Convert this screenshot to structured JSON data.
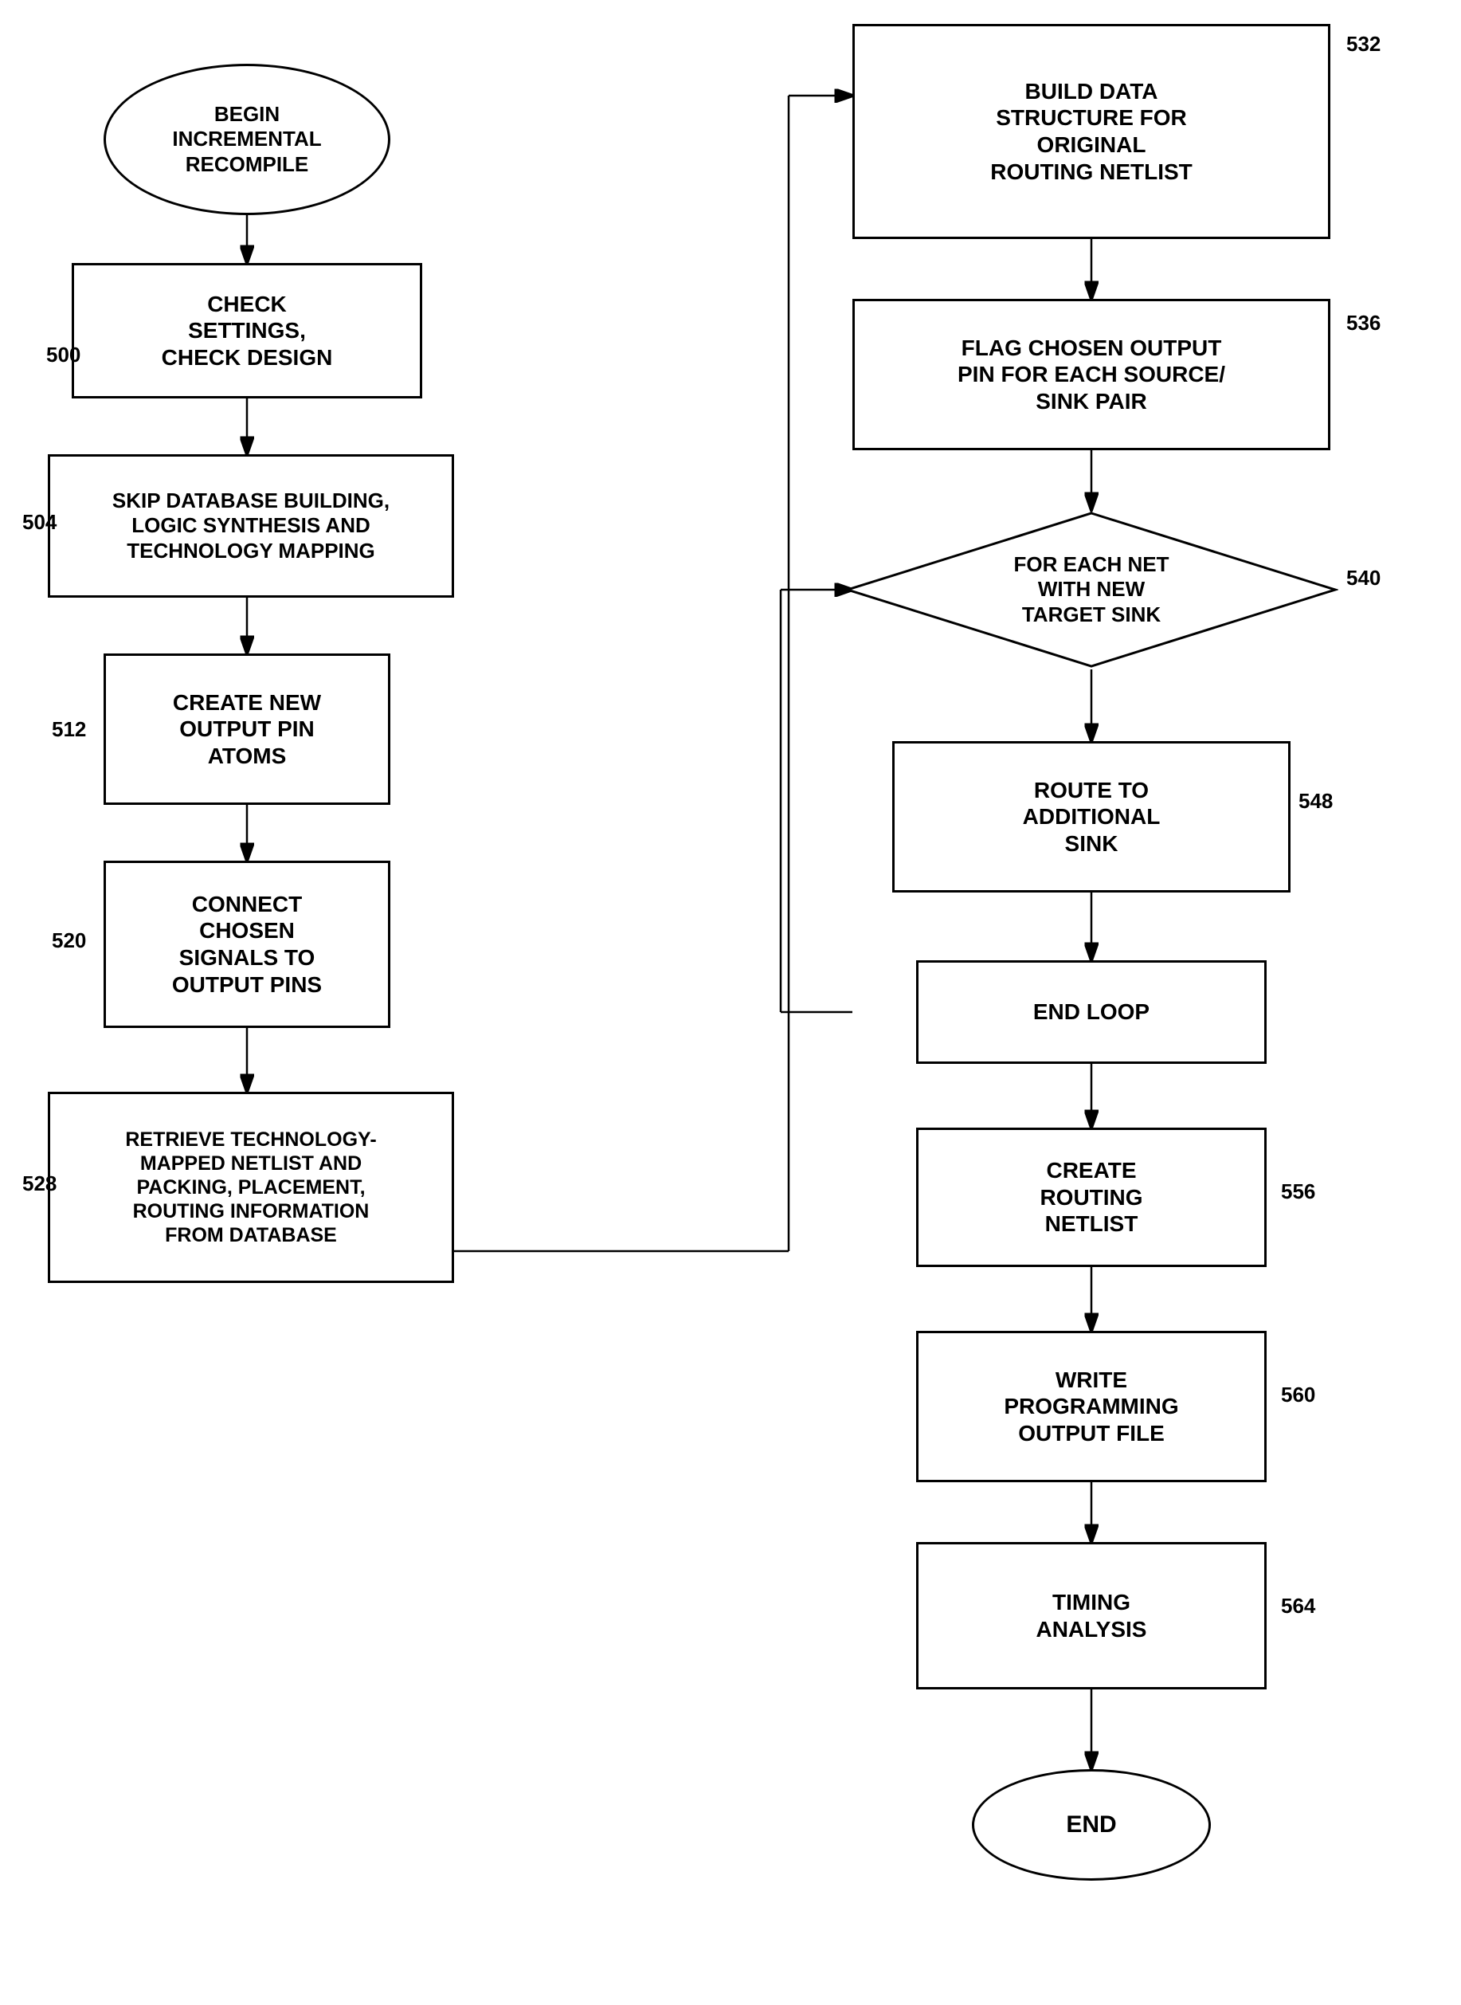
{
  "nodes": {
    "begin": {
      "label": "BEGIN\nINCREMENTAL\nRECOMPILE"
    },
    "n500": {
      "label": "CHECK\nSETTINGS,\nCHECK DESIGN",
      "ref": "500"
    },
    "n504": {
      "label": "SKIP DATABASE BUILDING,\nLOGIC SYNTHESIS AND\nTECHNOLOGY MAPPING",
      "ref": "504"
    },
    "n512": {
      "label": "CREATE NEW\nOUTPUT PIN\nATOMS",
      "ref": "512"
    },
    "n520": {
      "label": "CONNECT\nCHOSEN\nSIGNALS TO\nOUTPUT PINS",
      "ref": "520"
    },
    "n528": {
      "label": "RETRIEVE TECHNOLOGY-\nMAPPED NETLIST AND\nPACKING, PLACEMENT,\nROUTING INFORMATION\nFROM DATABASE",
      "ref": "528"
    },
    "n532": {
      "label": "BUILD DATA\nSTRUCTURE FOR\nORIGINAL\nROUTING NETLIST",
      "ref": "532"
    },
    "n536": {
      "label": "FLAG CHOSEN OUTPUT\nPIN FOR EACH SOURCE/\nSINK PAIR",
      "ref": "536"
    },
    "n540": {
      "label": "FOR EACH NET\nWITH NEW\nTARGET SINK",
      "ref": "540"
    },
    "n548": {
      "label": "ROUTE TO\nADDITIONAL\nSINK",
      "ref": "548"
    },
    "end_loop": {
      "label": "END LOOP"
    },
    "n556": {
      "label": "CREATE\nROUTING\nNETLIST",
      "ref": "556"
    },
    "n560": {
      "label": "WRITE\nPROGRAMMING\nOUTPUT FILE",
      "ref": "560"
    },
    "n564": {
      "label": "TIMING\nANALYSIS",
      "ref": "564"
    },
    "end": {
      "label": "END"
    }
  }
}
